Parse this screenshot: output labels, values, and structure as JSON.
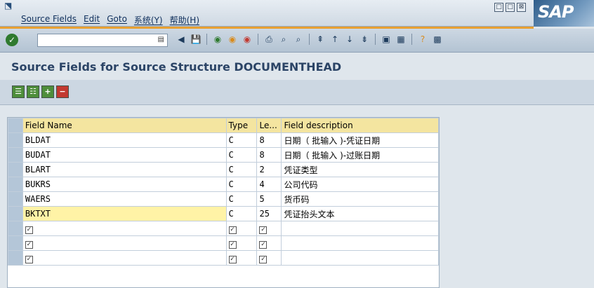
{
  "menubar": {
    "items": [
      "Source Fields",
      "Edit",
      "Goto",
      "系统(Y)",
      "帮助(H)"
    ]
  },
  "window_controls": [
    "□",
    "□",
    "⊠"
  ],
  "logo": "SAP",
  "toolbar": {
    "command_field_value": ""
  },
  "title": "Source Fields for Source Structure DOCUMENTHEAD",
  "table": {
    "headers": [
      "Field Name",
      "Type",
      "Le...",
      "Field description"
    ],
    "rows": [
      {
        "name": "BLDAT",
        "type": "C",
        "len": "8",
        "desc": "日期（ 批输入 )-凭证日期"
      },
      {
        "name": "BUDAT",
        "type": "C",
        "len": "8",
        "desc": "日期（ 批输入 )-过账日期"
      },
      {
        "name": "BLART",
        "type": "C",
        "len": "2",
        "desc": "凭证类型"
      },
      {
        "name": "BUKRS",
        "type": "C",
        "len": "4",
        "desc": "公司代码"
      },
      {
        "name": "WAERS",
        "type": "C",
        "len": "5",
        "desc": "货币码"
      },
      {
        "name": "BKTXT",
        "type": "C",
        "len": "25",
        "desc": "凭证抬头文本"
      }
    ]
  }
}
